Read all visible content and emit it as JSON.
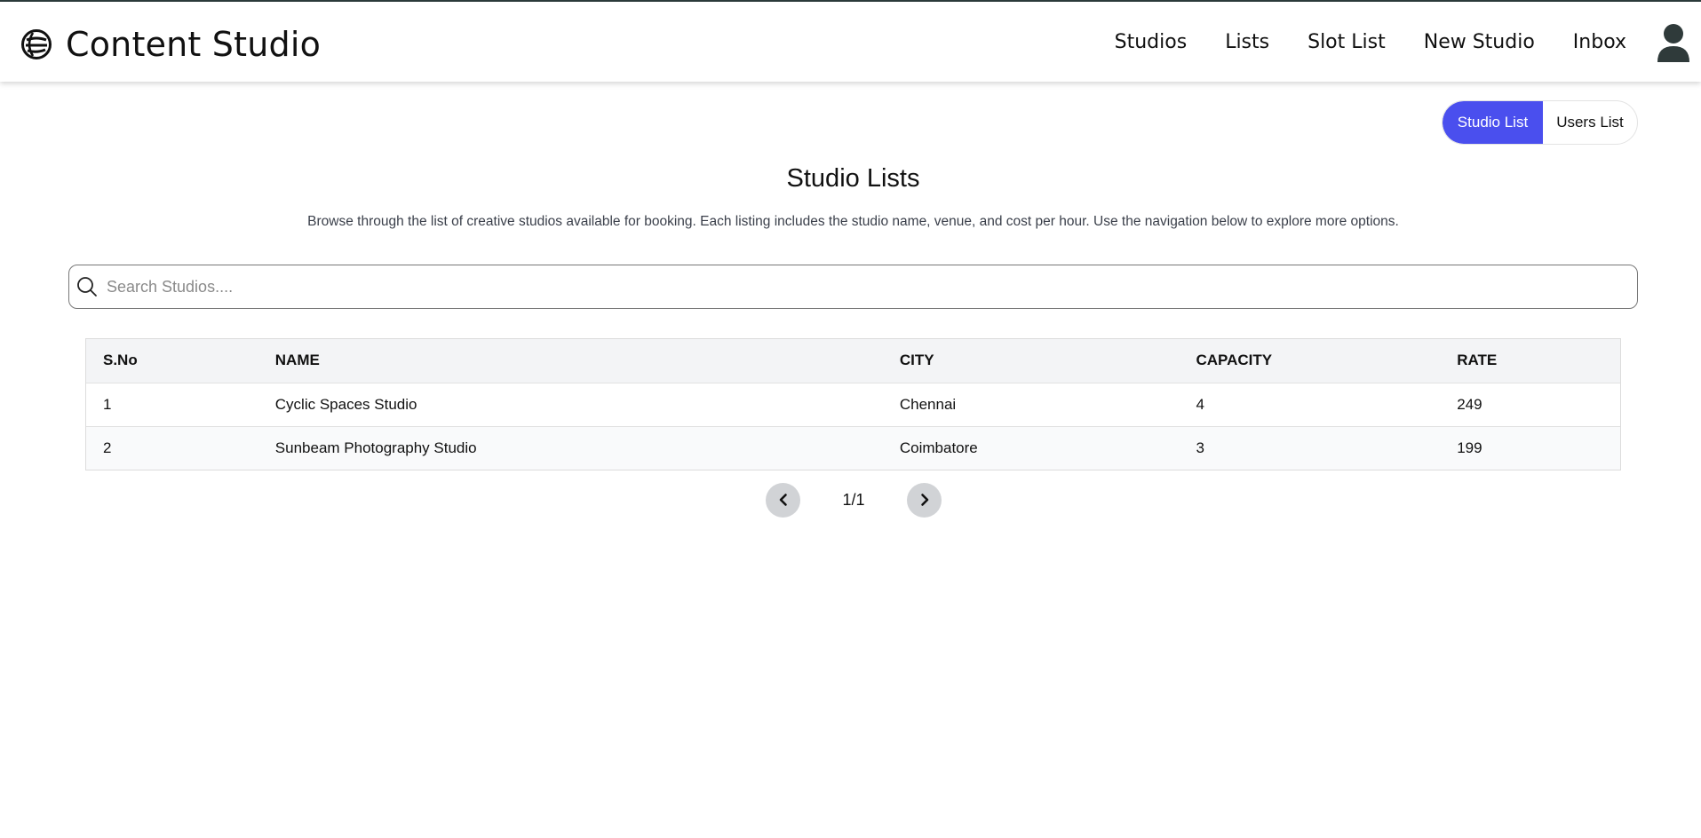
{
  "header": {
    "brand_title": "Content Studio",
    "logo_icon": "globe-logo-icon",
    "nav": [
      {
        "label": "Studios"
      },
      {
        "label": "Lists"
      },
      {
        "label": "Slot List"
      },
      {
        "label": "New Studio"
      },
      {
        "label": "Inbox"
      }
    ],
    "avatar_icon": "user-icon"
  },
  "toggle": {
    "studio_list": "Studio List",
    "users_list": "Users List",
    "active": "Studio List",
    "active_color": "#4a4fee"
  },
  "page": {
    "title": "Studio Lists",
    "description": "Browse through the list of creative studios available for booking. Each listing includes the studio name, venue, and cost per hour. Use the navigation below to explore more options."
  },
  "search": {
    "placeholder": "Search Studios....",
    "value": "",
    "icon": "search-icon"
  },
  "table": {
    "headers": [
      "S.No",
      "NAME",
      "CITY",
      "CAPACITY",
      "RATE"
    ],
    "rows": [
      {
        "sno": "1",
        "name": "Cyclic Spaces Studio",
        "city": "Chennai",
        "capacity": "4",
        "rate": "249"
      },
      {
        "sno": "2",
        "name": "Sunbeam Photography Studio",
        "city": "Coimbatore",
        "capacity": "3",
        "rate": "199"
      }
    ]
  },
  "pagination": {
    "text": "1/1",
    "prev_icon": "chevron-left-icon",
    "next_icon": "chevron-right-icon"
  }
}
